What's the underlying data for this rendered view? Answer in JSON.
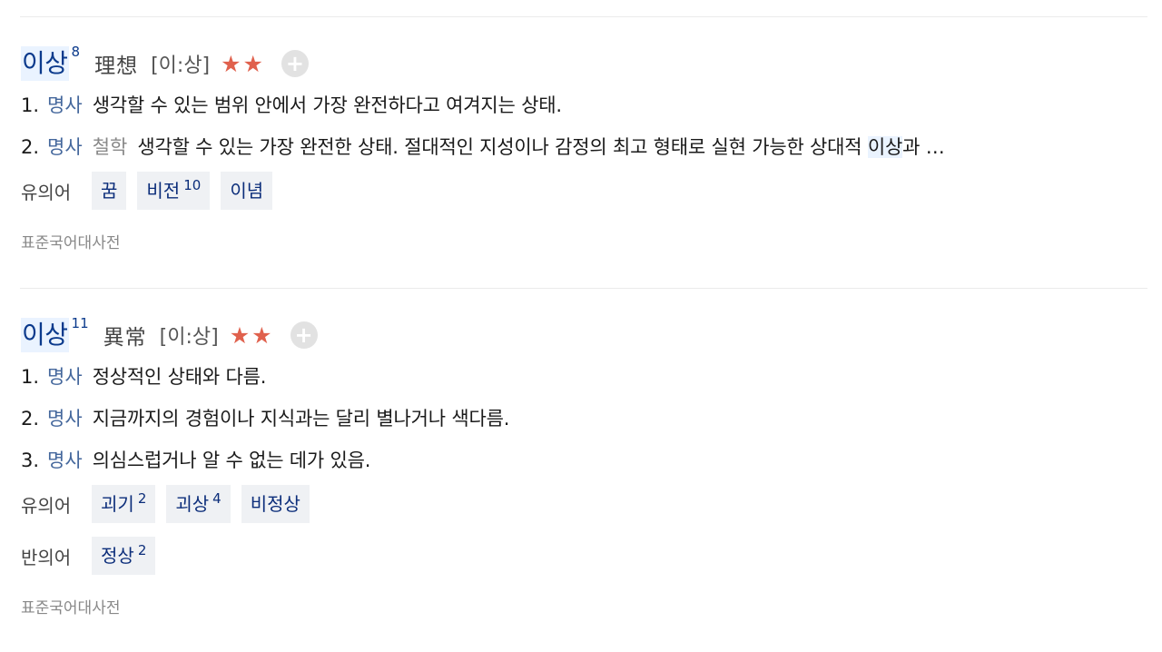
{
  "entries": [
    {
      "headword": "이상",
      "homonym": "8",
      "hanja": "理想",
      "pronunciation": "[이:상]",
      "stars": "★★",
      "plus": "+",
      "definitions": [
        {
          "num": "1.",
          "pos": "명사",
          "field": "",
          "text": "생각할 수 있는 범위 안에서 가장 완전하다고 여겨지는 상태."
        },
        {
          "num": "2.",
          "pos": "명사",
          "field": "철학",
          "text_before": "생각할 수 있는 가장 완전한 상태. 절대적인 지성이나 감정의 최고 형태로 실현 가능한 상대적 ",
          "text_hl": "이상",
          "text_after": "과 …"
        }
      ],
      "relations": [
        {
          "label": "유의어",
          "words": [
            {
              "w": "꿈",
              "sup": ""
            },
            {
              "w": "비전",
              "sup": "10"
            },
            {
              "w": "이념",
              "sup": ""
            }
          ]
        }
      ],
      "source": "표준국어대사전"
    },
    {
      "headword": "이상",
      "homonym": "11",
      "hanja": "異常",
      "pronunciation": "[이:상]",
      "stars": "★★",
      "plus": "+",
      "definitions": [
        {
          "num": "1.",
          "pos": "명사",
          "text": "정상적인 상태와 다름."
        },
        {
          "num": "2.",
          "pos": "명사",
          "text": "지금까지의 경험이나 지식과는 달리 별나거나 색다름."
        },
        {
          "num": "3.",
          "pos": "명사",
          "text": "의심스럽거나 알 수 없는 데가 있음."
        }
      ],
      "relations": [
        {
          "label": "유의어",
          "words": [
            {
              "w": "괴기",
              "sup": "2"
            },
            {
              "w": "괴상",
              "sup": "4"
            },
            {
              "w": "비정상",
              "sup": ""
            }
          ]
        },
        {
          "label": "반의어",
          "words": [
            {
              "w": "정상",
              "sup": "2"
            }
          ]
        }
      ],
      "source": "표준국어대사전"
    }
  ]
}
